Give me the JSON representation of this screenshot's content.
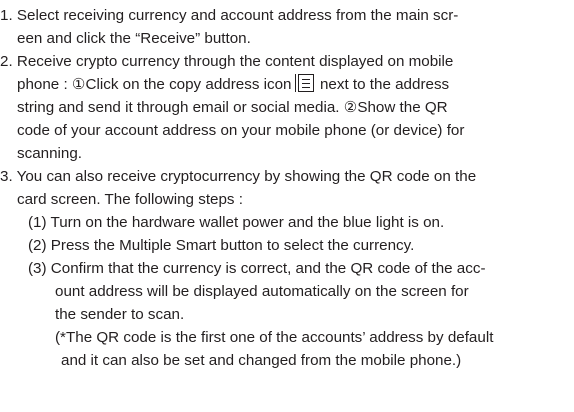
{
  "lines": [
    "1. Select receiving currency and account address from the main scr-",
    "een and click the “Receive” button.",
    "2. Receive crypto currency through the content displayed on mobile",
    "phone : ①Click on the copy address icon",
    "next to the address",
    "string and send it through email or social media. ②Show the QR",
    "code of your account address on your mobile phone (or device) for",
    "scanning.",
    "3. You can also receive cryptocurrency by showing the QR code on the",
    "card screen. The following steps :",
    "(1) Turn on the hardware wallet power and the blue light is on.",
    "(2) Press the Multiple Smart button to select the currency.",
    "(3) Confirm that the currency is correct, and the QR code of the acc-",
    "ount address will be displayed automatically on the screen for",
    "the sender to scan.",
    "(*The QR code is the first one of the accounts’ address by default",
    "and it can also be set and changed from the mobile phone.)"
  ],
  "icons": {
    "copy_address": "copy-address-icon"
  }
}
